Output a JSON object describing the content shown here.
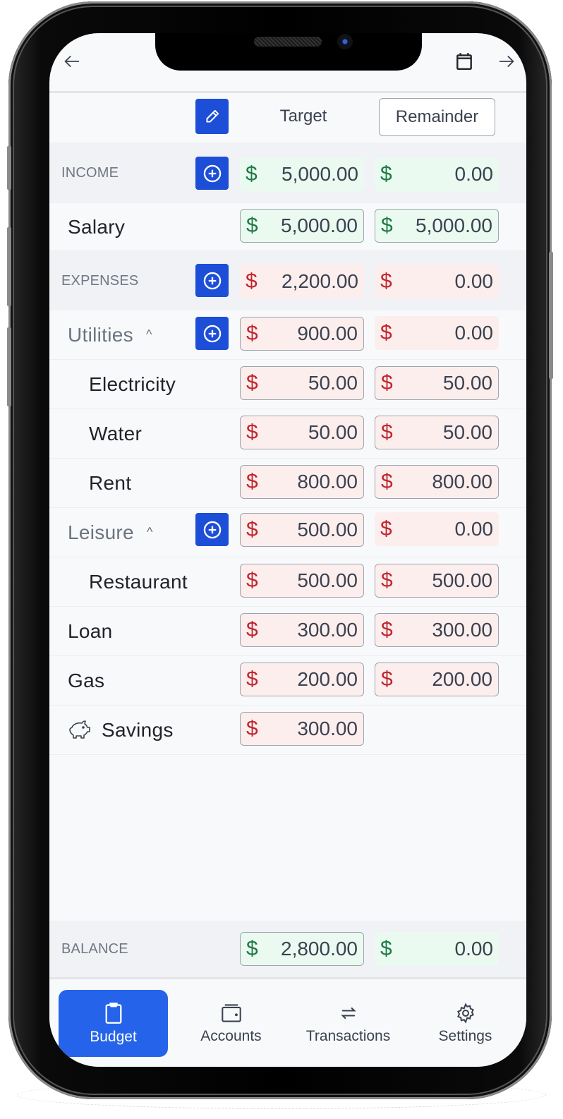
{
  "topbar": {
    "back_icon": "arrow-left-icon",
    "calendar_icon": "calendar-icon",
    "forward_icon": "arrow-right-icon"
  },
  "header": {
    "edit_icon": "pencil-icon",
    "target_label": "Target",
    "remainder_label": "Remainder"
  },
  "income": {
    "label": "INCOME",
    "target": "5,000.00",
    "remainder": "0.00",
    "items": [
      {
        "name": "Salary",
        "target": "5,000.00",
        "remainder": "5,000.00"
      }
    ]
  },
  "expenses": {
    "label": "EXPENSES",
    "target": "2,200.00",
    "remainder": "0.00",
    "groups": [
      {
        "name": "Utilities",
        "target": "900.00",
        "remainder": "0.00",
        "expanded": true,
        "items": [
          {
            "name": "Electricity",
            "target": "50.00",
            "remainder": "50.00"
          },
          {
            "name": "Water",
            "target": "50.00",
            "remainder": "50.00"
          },
          {
            "name": "Rent",
            "target": "800.00",
            "remainder": "800.00"
          }
        ]
      },
      {
        "name": "Leisure",
        "target": "500.00",
        "remainder": "0.00",
        "expanded": true,
        "items": [
          {
            "name": "Restaurant",
            "target": "500.00",
            "remainder": "500.00"
          }
        ]
      }
    ],
    "items": [
      {
        "name": "Loan",
        "target": "300.00",
        "remainder": "300.00"
      },
      {
        "name": "Gas",
        "target": "200.00",
        "remainder": "200.00"
      }
    ],
    "savings": {
      "name": "Savings",
      "icon": "piggy-bank-icon",
      "target": "300.00"
    }
  },
  "balance": {
    "label": "BALANCE",
    "target": "2,800.00",
    "remainder": "0.00"
  },
  "currency_symbol": "$",
  "colors": {
    "accent": "#1d4ed8",
    "tab_active": "#2563eb",
    "positive": "#1e7a46",
    "negative": "#c0262d"
  },
  "tabs": [
    {
      "label": "Budget",
      "icon": "clipboard-icon",
      "active": true
    },
    {
      "label": "Accounts",
      "icon": "wallet-icon",
      "active": false
    },
    {
      "label": "Transactions",
      "icon": "swap-arrows-icon",
      "active": false
    },
    {
      "label": "Settings",
      "icon": "gear-icon",
      "active": false
    }
  ]
}
